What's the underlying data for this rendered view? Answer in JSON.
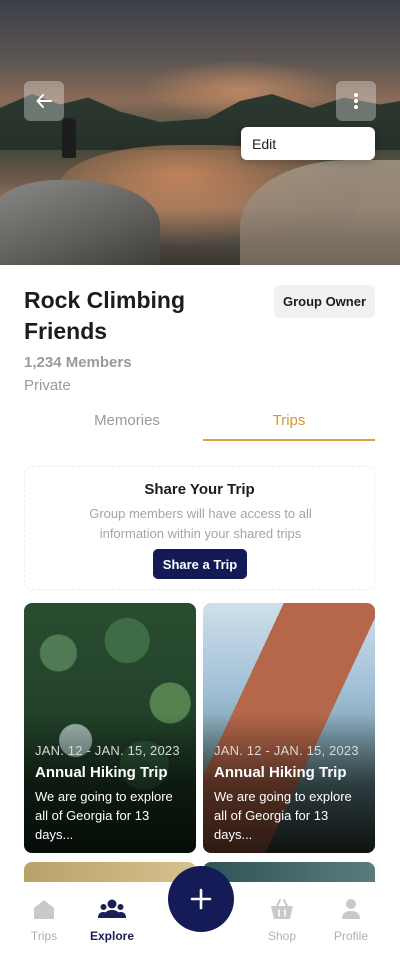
{
  "header": {
    "back_icon": "arrow-left-icon",
    "more_icon": "vertical-dots-icon",
    "menu": {
      "edit_label": "Edit"
    }
  },
  "group": {
    "title": "Rock Climbing Friends",
    "role_badge": "Group Owner",
    "members": "1,234 Members",
    "privacy": "Private"
  },
  "tabs": [
    {
      "label": "Memories",
      "active": false
    },
    {
      "label": "Trips",
      "active": true
    }
  ],
  "share": {
    "title": "Share Your Trip",
    "description": "Group members will have access to all information within your shared trips",
    "button_label": "Share a Trip"
  },
  "trips": [
    {
      "dates": "JAN. 12 - JAN. 15, 2023",
      "title": "Annual Hiking Trip",
      "description": "We are going to explore all of Georgia for 13 days..."
    },
    {
      "dates": "JAN. 12 - JAN. 15, 2023",
      "title": "Annual Hiking Trip",
      "description": "We are going to explore all of Georgia for 13 days..."
    }
  ],
  "nav": {
    "items": [
      {
        "label": "Trips",
        "icon": "home-icon",
        "active": false
      },
      {
        "label": "Explore",
        "icon": "people-icon",
        "active": true
      },
      {
        "label": "Shop",
        "icon": "basket-icon",
        "active": false
      },
      {
        "label": "Profile",
        "icon": "person-icon",
        "active": false
      }
    ],
    "fab_icon": "plus-icon"
  },
  "colors": {
    "primary": "#141b57",
    "accent": "#e0a23a",
    "muted_text": "#9a9a9a"
  }
}
